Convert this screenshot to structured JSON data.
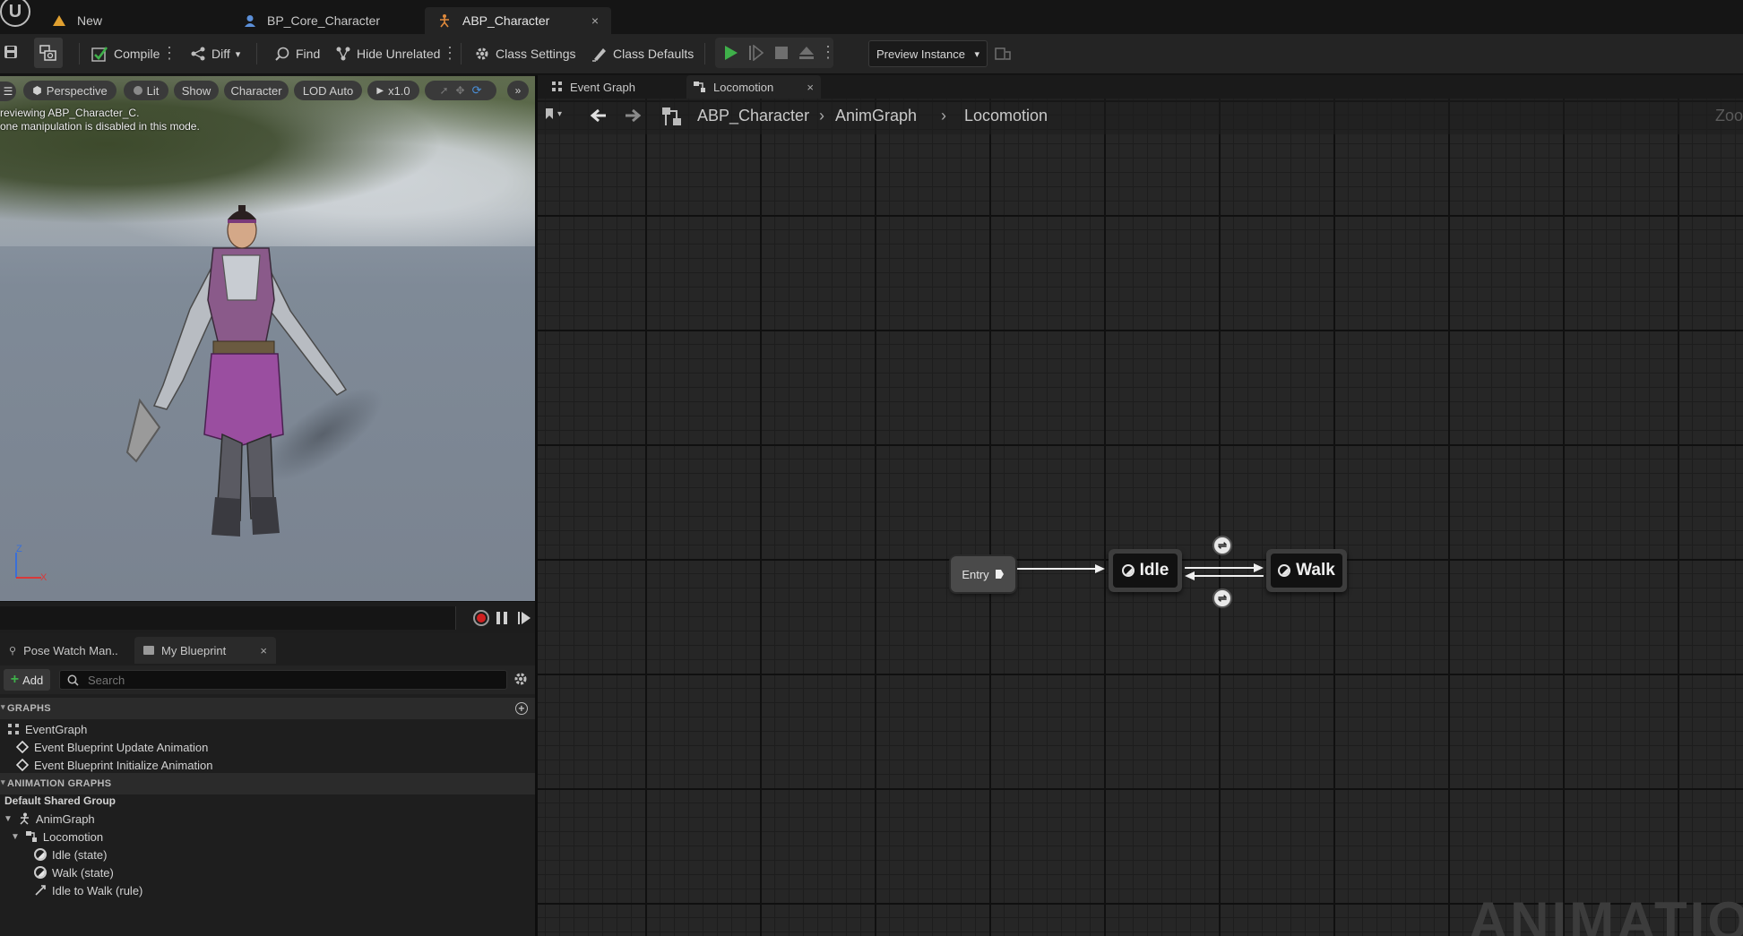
{
  "tabs": [
    {
      "label": "New"
    },
    {
      "label": "BP_Core_Character"
    },
    {
      "label": "ABP_Character",
      "close": "×"
    }
  ],
  "toolbar": {
    "compile": "Compile",
    "diff": "Diff",
    "find": "Find",
    "hide_unrelated": "Hide Unrelated",
    "class_settings": "Class Settings",
    "class_defaults": "Class Defaults",
    "preview_instance": "Preview Instance"
  },
  "viewport": {
    "perspective": "Perspective",
    "lit": "Lit",
    "show": "Show",
    "character": "Character",
    "lod": "LOD Auto",
    "speed": "x1.0",
    "note_line1": "reviewing ABP_Character_C.",
    "note_line2": "one manipulation is disabled in this mode.",
    "axis_z": "Z",
    "axis_x": "X"
  },
  "bp_panel": {
    "tab_pose": "Pose Watch Man..",
    "tab_blueprint": "My Blueprint",
    "tab_close": "×",
    "add": "Add",
    "search_placeholder": "Search",
    "graphs_header": "GRAPHS",
    "event_graph": "EventGraph",
    "event_update": "Event Blueprint Update Animation",
    "event_init": "Event Blueprint Initialize Animation",
    "anim_graphs_header": "ANIMATION GRAPHS",
    "shared_group": "Default Shared Group",
    "anim_graph": "AnimGraph",
    "locomotion": "Locomotion",
    "idle_state": "Idle (state)",
    "walk_state": "Walk (state)",
    "idle_to_walk": "Idle to Walk (rule)"
  },
  "graph_tabs": [
    {
      "label": "Event Graph"
    },
    {
      "label": "Locomotion",
      "close": "×"
    }
  ],
  "breadcrumb": {
    "root": "ABP_Character",
    "mid": "AnimGraph",
    "leaf": "Locomotion",
    "zoom": "Zoo"
  },
  "nodes": {
    "entry": "Entry",
    "idle": "Idle",
    "walk": "Walk"
  },
  "watermark": "ANIMATIO",
  "colors": {
    "play": "#3fb04a",
    "record": "#d02020",
    "accent_tab": "#242424"
  }
}
